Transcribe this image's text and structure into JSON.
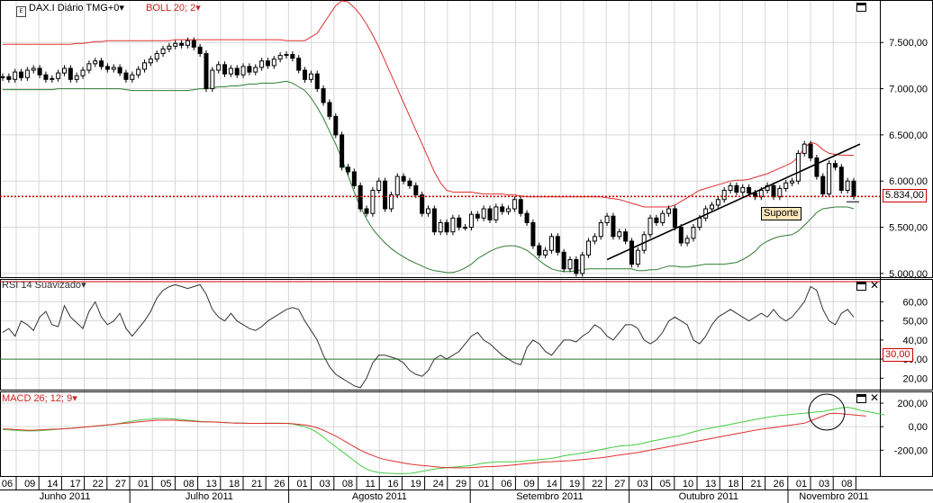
{
  "header": {
    "symbol": "DAX.I Diário TMG+0",
    "symbol_arrow": "▾",
    "boll": "BOLL 20; 2",
    "boll_arrow": "▾",
    "rsi": "RSI 14 Suavizado",
    "rsi_arrow": "▾",
    "macd": "MACD 26; 12; 9",
    "macd_arrow": "▾"
  },
  "badges": {
    "last_price": "5.834,00",
    "rsi_level": "30,00",
    "support": "Suporte"
  },
  "colors": {
    "boll_upper": "#e03030",
    "boll_lower": "#2e7d32",
    "support_line": "#cc0000",
    "rsi_line": "#333333",
    "rsi_level": "#2e7d32",
    "macd_line": "#e03030",
    "signal_line": "#44cc44",
    "grid": "#d8d8d8"
  },
  "chart_data": [
    {
      "type": "line",
      "panel": "price",
      "series_label": "DAX.I Diário TMG+0",
      "yticks": [
        "7.500,00",
        "7.000,00",
        "6.500,00",
        "6.000,00",
        "5.500,00",
        "5.000,00"
      ],
      "ytick_values": [
        7500,
        7000,
        6500,
        6000,
        5500,
        5000
      ],
      "ylim": [
        4960,
        7960
      ],
      "x_day_labels": [
        "06",
        "09",
        "14",
        "17",
        "22",
        "27",
        "01",
        "05",
        "08",
        "13",
        "18",
        "21",
        "26",
        "01",
        "03",
        "08",
        "11",
        "16",
        "19",
        "24",
        "29",
        "01",
        "06",
        "09",
        "14",
        "19",
        "22",
        "27",
        "03",
        "05",
        "10",
        "13",
        "18",
        "21",
        "26",
        "01",
        "03",
        "08"
      ],
      "x_month_labels": [
        "Junho 2011",
        "Julho 2011",
        "Agosto 2011",
        "Setembro 2011",
        "Outubro 2011",
        "Novembro 2011"
      ],
      "close": [
        7130,
        7100,
        7180,
        7120,
        7200,
        7220,
        7150,
        7100,
        7110,
        7170,
        7220,
        7100,
        7140,
        7200,
        7270,
        7300,
        7240,
        7210,
        7230,
        7170,
        7100,
        7150,
        7210,
        7280,
        7320,
        7380,
        7430,
        7460,
        7490,
        7470,
        7520,
        7450,
        7380,
        7000,
        7200,
        7260,
        7160,
        7220,
        7150,
        7240,
        7180,
        7230,
        7300,
        7250,
        7320,
        7360,
        7370,
        7330,
        7200,
        7100,
        7160,
        7000,
        6850,
        6700,
        6500,
        6150,
        6100,
        5950,
        5700,
        5650,
        5900,
        6000,
        5700,
        5850,
        6050,
        6000,
        5950,
        5850,
        5650,
        5700,
        5450,
        5550,
        5450,
        5600,
        5500,
        5500,
        5640,
        5600,
        5700,
        5580,
        5720,
        5670,
        5700,
        5800,
        5650,
        5550,
        5300,
        5200,
        5250,
        5400,
        5230,
        5050,
        5150,
        5000,
        5200,
        5350,
        5400,
        5550,
        5620,
        5400,
        5450,
        5350,
        5100,
        5250,
        5420,
        5600,
        5550,
        5650,
        5700,
        5500,
        5330,
        5380,
        5500,
        5600,
        5700,
        5740,
        5800,
        5900,
        5950,
        5880,
        5930,
        5870,
        5830,
        5900,
        5950,
        5830,
        5920,
        5980,
        6000,
        6300,
        6400,
        6250,
        6050,
        5860,
        6190,
        6150,
        5900,
        6000,
        5834
      ],
      "boll_upper": [
        7480,
        7480,
        7480,
        7480,
        7480,
        7480,
        7480,
        7480,
        7480,
        7480,
        7480,
        7480,
        7490,
        7490,
        7500,
        7510,
        7510,
        7520,
        7520,
        7520,
        7520,
        7520,
        7520,
        7520,
        7520,
        7520,
        7520,
        7520,
        7530,
        7530,
        7530,
        7530,
        7530,
        7530,
        7530,
        7530,
        7530,
        7530,
        7530,
        7530,
        7530,
        7530,
        7530,
        7530,
        7530,
        7530,
        7520,
        7520,
        7520,
        7520,
        7560,
        7600,
        7700,
        7800,
        7900,
        7950,
        7940,
        7880,
        7800,
        7700,
        7580,
        7450,
        7300,
        7150,
        7000,
        6850,
        6700,
        6550,
        6400,
        6250,
        6100,
        5980,
        5900,
        5880,
        5880,
        5880,
        5880,
        5870,
        5860,
        5860,
        5860,
        5860,
        5850,
        5850,
        5840,
        5830,
        5830,
        5830,
        5830,
        5830,
        5830,
        5830,
        5830,
        5830,
        5830,
        5830,
        5830,
        5830,
        5820,
        5810,
        5800,
        5780,
        5760,
        5740,
        5720,
        5720,
        5720,
        5720,
        5720,
        5740,
        5780,
        5820,
        5860,
        5900,
        5920,
        5940,
        5960,
        5980,
        6000,
        6010,
        6010,
        6020,
        6040,
        6060,
        6080,
        6110,
        6140,
        6170,
        6200,
        6260,
        6360,
        6420,
        6400,
        6340,
        6300,
        6290,
        6280,
        6280,
        6280
      ],
      "boll_lower": [
        6990,
        6990,
        6990,
        6990,
        6990,
        6990,
        6990,
        6990,
        6990,
        7000,
        7000,
        7000,
        7000,
        7000,
        7000,
        7000,
        7000,
        7000,
        7000,
        7000,
        6990,
        6980,
        6980,
        6980,
        6980,
        6980,
        6980,
        6980,
        6980,
        6980,
        6980,
        6990,
        7000,
        7000,
        7010,
        7020,
        7020,
        7030,
        7030,
        7040,
        7050,
        7050,
        7060,
        7060,
        7060,
        7070,
        7080,
        7060,
        7020,
        6980,
        6900,
        6800,
        6680,
        6540,
        6400,
        6240,
        6060,
        5880,
        5720,
        5590,
        5480,
        5400,
        5330,
        5270,
        5220,
        5180,
        5140,
        5110,
        5080,
        5050,
        5030,
        5020,
        5010,
        5010,
        5030,
        5060,
        5100,
        5160,
        5200,
        5240,
        5270,
        5290,
        5300,
        5300,
        5280,
        5250,
        5200,
        5140,
        5090,
        5050,
        5030,
        5020,
        5020,
        5030,
        5040,
        5050,
        5050,
        5050,
        5050,
        5050,
        5050,
        5050,
        5050,
        5030,
        5030,
        5040,
        5040,
        5060,
        5080,
        5080,
        5070,
        5070,
        5080,
        5090,
        5100,
        5100,
        5100,
        5100,
        5110,
        5120,
        5150,
        5190,
        5240,
        5310,
        5350,
        5380,
        5400,
        5410,
        5420,
        5460,
        5520,
        5590,
        5660,
        5700,
        5710,
        5720,
        5720,
        5720,
        5700
      ],
      "support_level": 5834,
      "trendline": {
        "start": 5150,
        "end": 6400
      }
    },
    {
      "type": "line",
      "panel": "rsi",
      "series_label": "RSI 14 Suavizado",
      "yticks": [
        "60,00",
        "50,00",
        "40,00",
        "30,00",
        "20,00"
      ],
      "ytick_values": [
        60,
        50,
        40,
        30,
        20
      ],
      "ylim": [
        14,
        72
      ],
      "level": 30,
      "values": [
        44,
        46,
        42,
        50,
        48,
        45,
        52,
        55,
        48,
        47,
        58,
        52,
        49,
        46,
        55,
        60,
        52,
        48,
        50,
        54,
        46,
        42,
        46,
        50,
        55,
        62,
        66,
        68,
        69,
        68,
        67,
        68,
        69,
        64,
        56,
        52,
        50,
        54,
        50,
        48,
        46,
        45,
        47,
        50,
        52,
        54,
        56,
        57,
        56,
        50,
        45,
        40,
        32,
        26,
        22,
        20,
        18,
        16,
        15,
        20,
        28,
        32,
        32,
        31,
        30,
        28,
        24,
        22,
        21,
        24,
        30,
        32,
        30,
        32,
        34,
        38,
        42,
        44,
        40,
        38,
        35,
        32,
        30,
        28,
        27,
        36,
        40,
        38,
        34,
        32,
        36,
        40,
        40,
        39,
        42,
        44,
        48,
        46,
        42,
        40,
        44,
        48,
        48,
        46,
        40,
        38,
        40,
        44,
        50,
        52,
        50,
        48,
        40,
        38,
        42,
        48,
        52,
        54,
        56,
        54,
        52,
        50,
        52,
        54,
        52,
        56,
        52,
        50,
        52,
        56,
        60,
        68,
        66,
        56,
        50,
        48,
        54,
        56,
        52
      ],
      "color": "#333333"
    },
    {
      "type": "line",
      "panel": "macd",
      "series_label": "MACD 26; 12; 9",
      "yticks": [
        "200,00",
        "0,00",
        "-200,00"
      ],
      "ytick_values": [
        200,
        0,
        -200
      ],
      "ylim": [
        -420,
        300
      ],
      "series": [
        {
          "values": [
            -20,
            -20,
            -25,
            -28,
            -30,
            -30,
            -28,
            -25,
            -22,
            -20,
            -18,
            -15,
            -10,
            -5,
            0,
            5,
            10,
            15,
            20,
            25,
            30,
            35,
            40,
            45,
            50,
            55,
            55,
            55,
            55,
            50,
            48,
            45,
            42,
            40,
            40,
            38,
            35,
            32,
            30,
            30,
            28,
            28,
            28,
            28,
            28,
            28,
            28,
            25,
            20,
            15,
            5,
            -10,
            -30,
            -55,
            -80,
            -110,
            -140,
            -170,
            -200,
            -225,
            -245,
            -265,
            -280,
            -290,
            -300,
            -310,
            -318,
            -325,
            -330,
            -335,
            -340,
            -345,
            -348,
            -350,
            -350,
            -350,
            -348,
            -345,
            -342,
            -340,
            -338,
            -335,
            -330,
            -325,
            -320,
            -315,
            -310,
            -305,
            -300,
            -298,
            -295,
            -292,
            -290,
            -285,
            -280,
            -275,
            -270,
            -265,
            -258,
            -250,
            -242,
            -235,
            -228,
            -220,
            -210,
            -200,
            -190,
            -180,
            -170,
            -160,
            -150,
            -140,
            -130,
            -120,
            -110,
            -100,
            -90,
            -80,
            -70,
            -60,
            -50,
            -40,
            -30,
            -22,
            -15,
            -8,
            0,
            8,
            15,
            22,
            30,
            50,
            70,
            90,
            110,
            115,
            110,
            105,
            100,
            95,
            90
          ]
        },
        {
          "values": [
            -25,
            -28,
            -32,
            -35,
            -36,
            -36,
            -34,
            -30,
            -26,
            -22,
            -18,
            -14,
            -10,
            -5,
            0,
            5,
            10,
            15,
            20,
            28,
            38,
            48,
            55,
            60,
            65,
            70,
            70,
            68,
            65,
            60,
            55,
            50,
            45,
            42,
            40,
            38,
            35,
            32,
            30,
            30,
            28,
            28,
            28,
            30,
            30,
            30,
            28,
            22,
            12,
            0,
            -20,
            -50,
            -90,
            -130,
            -170,
            -210,
            -250,
            -290,
            -330,
            -360,
            -380,
            -390,
            -395,
            -398,
            -400,
            -400,
            -398,
            -390,
            -380,
            -370,
            -360,
            -355,
            -350,
            -345,
            -340,
            -335,
            -330,
            -320,
            -310,
            -305,
            -300,
            -300,
            -300,
            -298,
            -295,
            -290,
            -285,
            -280,
            -275,
            -270,
            -260,
            -248,
            -240,
            -232,
            -225,
            -215,
            -205,
            -195,
            -185,
            -175,
            -165,
            -160,
            -158,
            -150,
            -140,
            -125,
            -115,
            -105,
            -95,
            -85,
            -75,
            -60,
            -45,
            -30,
            -20,
            -10,
            0,
            10,
            20,
            30,
            40,
            50,
            60,
            70,
            80,
            88,
            95,
            100,
            105,
            110,
            115,
            120,
            125,
            130,
            140,
            150,
            160,
            165,
            155,
            140,
            130,
            120,
            110,
            100
          ]
        }
      ]
    }
  ]
}
